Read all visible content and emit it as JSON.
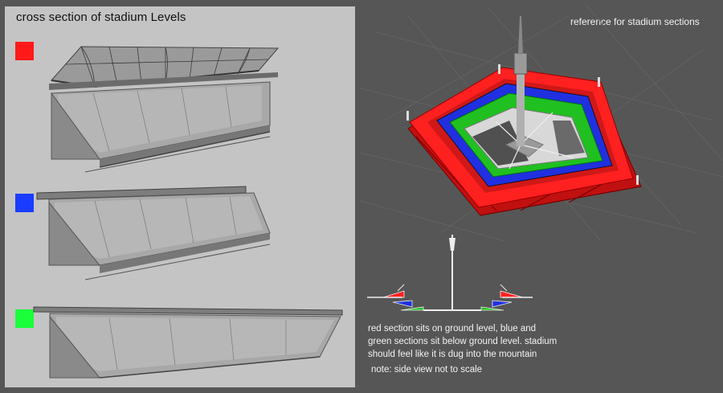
{
  "left_title": "cross section of stadium Levels",
  "right_title": "reference for stadium sections",
  "levels": [
    {
      "level": "red",
      "color": "#ff1a1a"
    },
    {
      "level": "blue",
      "color": "#1a3cff"
    },
    {
      "level": "green",
      "color": "#1aff3a"
    }
  ],
  "notes": {
    "main": "red section sits on ground level, blue and green sections sit below ground level. stadium should feel like it is dug into the mountain",
    "note": "note: side view not to scale"
  }
}
